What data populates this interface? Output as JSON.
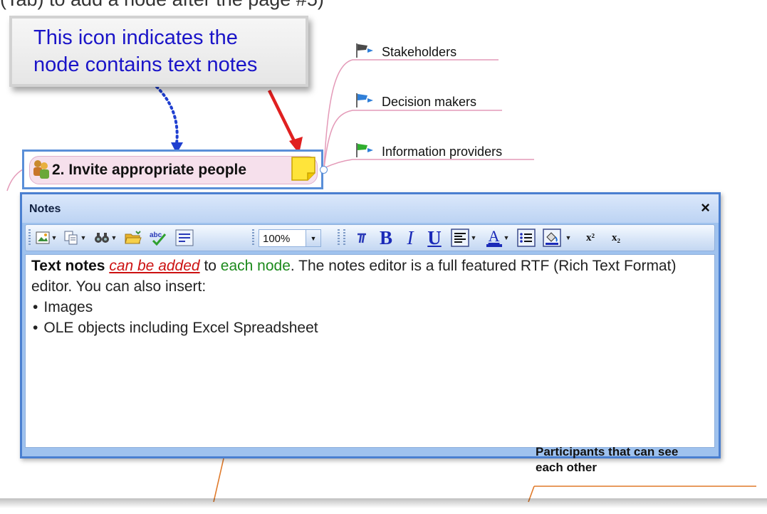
{
  "top_caption": "(Tab) to add a node after the page #5)",
  "callout": {
    "line1": "This icon indicates the",
    "line2": "node contains text notes"
  },
  "map": {
    "branches": [
      {
        "label": "Stakeholders",
        "flag_color": "#4a4a4a"
      },
      {
        "label": "Decision makers",
        "flag_color": "#2f7fd8"
      },
      {
        "label": "Information providers",
        "flag_color": "#2fae2f"
      }
    ],
    "main_node": {
      "label": "2. Invite appropriate people"
    },
    "partial_node": {
      "line1": "Participants that can see",
      "line2": "each other"
    }
  },
  "notes_window": {
    "title": "Notes",
    "close_symbol": "×",
    "toolbar": {
      "zoom_value": "100%",
      "bold": "B",
      "italic": "I",
      "underline": "U",
      "font_color_letter": "A",
      "superscript": "x²",
      "subscript": "x₂"
    },
    "editor": {
      "para_bold": "Text notes",
      "para_red": "can be added",
      "para_mid": " to ",
      "para_green": "each node",
      "para_rest": ". The notes editor is a full featured RTF (Rich Text Format) editor. You can also insert:",
      "bullets": [
        "Images",
        "OLE objects including Excel Spreadsheet"
      ]
    }
  },
  "colors": {
    "callout_text": "#1a14c8",
    "notes_border": "#4a7fd0",
    "branch_line_pink": "#e49ab8",
    "branch_line_orange": "#e07a2a",
    "arrow_red": "#e02020",
    "arrow_blue": "#1f3fd0"
  }
}
